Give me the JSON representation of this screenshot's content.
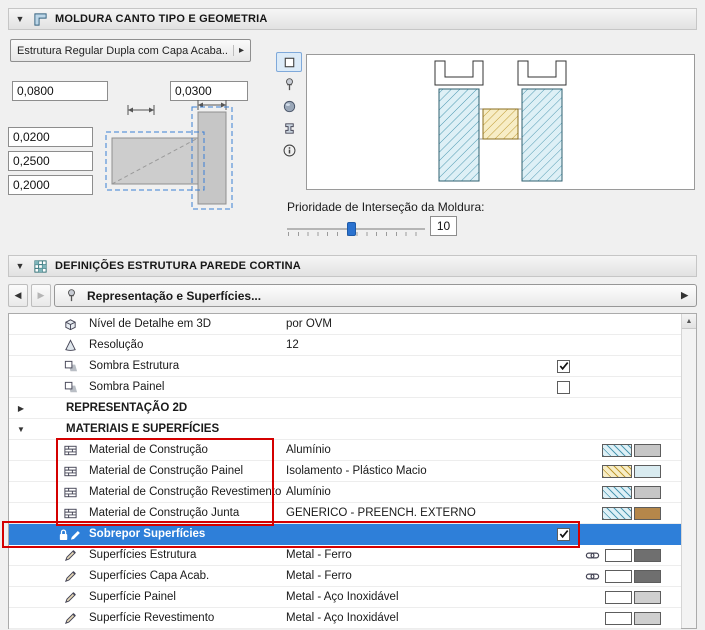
{
  "colors": {
    "selection_blue": "#2e7fd9",
    "highlight_red": "#d40000",
    "panel_background": "#f0f0f0"
  },
  "frame_panel": {
    "title": "MOLDURA CANTO TIPO E GEOMETRIA",
    "type_popup": {
      "label": "Estrutura Regular Dupla com Capa Acaba..."
    },
    "size_fields": [
      {
        "value": "0,0800"
      },
      {
        "value": "0,0300"
      }
    ],
    "offset_fields": [
      {
        "value": "0,0200"
      },
      {
        "value": "0,2500"
      },
      {
        "value": "0,2000"
      }
    ],
    "view_toolbar": [
      "plan-view",
      "pin",
      "3d-view",
      "profile",
      "info"
    ],
    "priority": {
      "label": "Prioridade de Interseção da Moldura:",
      "value": "10"
    }
  },
  "settings_panel": {
    "title": "DEFINIÇÕES ESTRUTURA PAREDE CORTINA",
    "breadcrumb": "Representação e Superfícies...",
    "rows": [
      {
        "kind": "item",
        "icon": "detail3d",
        "label": "Nível de Detalhe em 3D",
        "value": "por OVM"
      },
      {
        "kind": "item",
        "icon": "resolution",
        "label": "Resolução",
        "value": "12"
      },
      {
        "kind": "item",
        "icon": "shadow",
        "label": "Sombra Estrutura",
        "checkbox": true
      },
      {
        "kind": "item",
        "icon": "shadow",
        "label": "Sombra Painel",
        "checkbox": false
      },
      {
        "kind": "group",
        "expanded": false,
        "label": "REPRESENTAÇÃO 2D"
      },
      {
        "kind": "group",
        "expanded": true,
        "label": "MATERIAIS E SUPERFÍCIES"
      },
      {
        "kind": "item",
        "icon": "material",
        "label": "Material de Construção",
        "value": "Alumínio",
        "swatches": [
          {
            "fill": "#def0f6",
            "line": "#4f9ab2"
          },
          {
            "fill": "#c6c6c6"
          }
        ]
      },
      {
        "kind": "item",
        "icon": "material",
        "label": "Material de Construção Painel",
        "value": "Isolamento - Plástico Macio",
        "swatches": [
          {
            "fill": "#f7edc6",
            "line": "#bf9a33"
          },
          {
            "fill": "#d9ebf0"
          }
        ]
      },
      {
        "kind": "item",
        "icon": "material",
        "label": "Material de Construção Revestimento",
        "value": "Alumínio",
        "swatches": [
          {
            "fill": "#def0f6",
            "line": "#4f9ab2"
          },
          {
            "fill": "#c6c6c6"
          }
        ]
      },
      {
        "kind": "item",
        "icon": "material",
        "label": "Material de Construção Junta",
        "value": "GENÉRICO - PREENCH. EXTERNO",
        "swatches": [
          {
            "fill": "#def0f6",
            "line": "#4f9ab2"
          },
          {
            "fill": "#b5874a"
          }
        ]
      },
      {
        "kind": "item",
        "icon": "override",
        "label": "Sobrepor Superfícies",
        "checkbox": true,
        "selected": true
      },
      {
        "kind": "item",
        "icon": "surface",
        "label": "Superfícies Estrutura",
        "value": "Metal - Ferro",
        "chain": true,
        "swatches": [
          {
            "fill": "#ffffff"
          },
          {
            "fill": "#6f6f6f"
          }
        ]
      },
      {
        "kind": "item",
        "icon": "surface",
        "label": "Superfícies Capa Acab.",
        "value": "Metal - Ferro",
        "chain": true,
        "swatches": [
          {
            "fill": "#ffffff"
          },
          {
            "fill": "#6f6f6f"
          }
        ]
      },
      {
        "kind": "item",
        "icon": "surface",
        "label": "Superfície Painel",
        "value": "Metal - Aço Inoxidável",
        "swatches": [
          {
            "fill": "#ffffff"
          },
          {
            "fill": "#cfcfcf"
          }
        ]
      },
      {
        "kind": "item",
        "icon": "surface",
        "label": "Superfície Revestimento",
        "value": "Metal - Aço Inoxidável",
        "swatches": [
          {
            "fill": "#ffffff"
          },
          {
            "fill": "#cfcfcf"
          }
        ]
      }
    ]
  }
}
